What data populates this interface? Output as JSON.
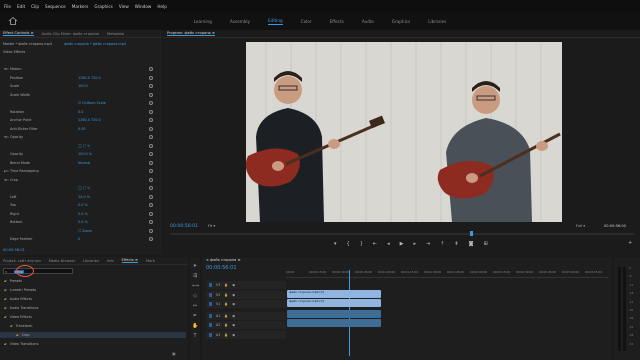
{
  "menu": [
    "File",
    "Edit",
    "Clip",
    "Sequence",
    "Markers",
    "Graphics",
    "View",
    "Window",
    "Help"
  ],
  "workspaces": [
    "Learning",
    "Assembly",
    "Editing",
    "Color",
    "Effects",
    "Audio",
    "Graphics",
    "Libraries"
  ],
  "active_workspace": "Editing",
  "effect_controls": {
    "tabs": [
      "Effect Controls ≡",
      "Audio Clip Mixer: фейк сторона",
      "Metadata"
    ],
    "source_line": "Master * фейк сторона.mp4",
    "clip_line": "фейк сторона * фейк сторона.mp4",
    "section": "Video Effects",
    "rows": [
      {
        "tri": "▼",
        "fx": "fx",
        "label": "Motion",
        "value": ""
      },
      {
        "tri": "",
        "fx": "",
        "label": "Position",
        "value": "1280.0    720.0"
      },
      {
        "tri": "",
        "fx": "",
        "label": "Scale",
        "value": "100.0"
      },
      {
        "tri": "",
        "fx": "",
        "label": "Scale Width",
        "value": ""
      },
      {
        "tri": "",
        "fx": "",
        "label": "",
        "value": "☑ Uniform Scale"
      },
      {
        "tri": "",
        "fx": "",
        "label": "Rotation",
        "value": "0.0"
      },
      {
        "tri": "",
        "fx": "",
        "label": "Anchor Point",
        "value": "1280.0    720.0"
      },
      {
        "tri": "",
        "fx": "",
        "label": "Anti-flicker Filter",
        "value": "0.00"
      },
      {
        "tri": "▼",
        "fx": "fx",
        "label": "Opacity",
        "value": ""
      },
      {
        "tri": "",
        "fx": "",
        "label": "",
        "value": "◯ ▢ ✎"
      },
      {
        "tri": "",
        "fx": "",
        "label": "Opacity",
        "value": "100.0 %"
      },
      {
        "tri": "",
        "fx": "",
        "label": "Blend Mode",
        "value": "Normal"
      },
      {
        "tri": "▶",
        "fx": "fx",
        "label": "Time Remapping",
        "value": ""
      },
      {
        "tri": "▼",
        "fx": "fx",
        "label": "Crop",
        "value": ""
      },
      {
        "tri": "",
        "fx": "",
        "label": "",
        "value": "◯ ▢ ✎"
      },
      {
        "tri": "",
        "fx": "",
        "label": "Left",
        "value": "14.0 %"
      },
      {
        "tri": "",
        "fx": "",
        "label": "Top",
        "value": "0.0 %"
      },
      {
        "tri": "",
        "fx": "",
        "label": "Right",
        "value": "0.0 %"
      },
      {
        "tri": "",
        "fx": "",
        "label": "Bottom",
        "value": "0.0 %"
      },
      {
        "tri": "",
        "fx": "",
        "label": "",
        "value": "☐ Zoom"
      },
      {
        "tri": "",
        "fx": "",
        "label": "Edge Feather",
        "value": "0"
      }
    ],
    "timecode": "00:00:56:01"
  },
  "program": {
    "title": "Program: фейк сторона ≡",
    "timecode": "00:00:56:01",
    "fit": "Fit",
    "quality": "Full",
    "duration": "00:00:56:00"
  },
  "project": {
    "tabs": [
      "Project: сайт внутри",
      "Media Browser",
      "Libraries",
      "Info",
      "Effects ≡",
      "Mark"
    ],
    "search": "crop",
    "items": [
      {
        "indent": 0,
        "label": "Presets"
      },
      {
        "indent": 0,
        "label": "Lumetri Presets"
      },
      {
        "indent": 0,
        "label": "Audio Effects"
      },
      {
        "indent": 0,
        "label": "Audio Transitions"
      },
      {
        "indent": 0,
        "label": "Video Effects"
      },
      {
        "indent": 1,
        "label": "Transform"
      },
      {
        "indent": 2,
        "label": "Crop"
      },
      {
        "indent": 0,
        "label": "Video Transitions"
      }
    ]
  },
  "timeline": {
    "tab": "× фейк сторона ≡",
    "timecode": "00:00:56:01",
    "ruler": [
      "00:00",
      "00:00:15:00",
      "00:00:30:00",
      "00:00:45:00",
      "00:01:00:00",
      "00:01:15:00",
      "00:01:30:00",
      "00:01:45:00",
      "00:02:00:00",
      "00:02:15:00",
      "00:02:30:00",
      "00:02:45:00",
      "00:03:00:00",
      "00:03:15:00"
    ],
    "tracks": [
      "V3",
      "V2",
      "V1",
      "A1",
      "A2",
      "A3"
    ],
    "clips": [
      {
        "label": "фейк сторона.mp4 [V]",
        "track": "V2"
      },
      {
        "label": "фейк сторона.mp4 [V]",
        "track": "V1"
      }
    ],
    "meter_labels": [
      "0",
      "-6",
      "-12",
      "-18",
      "-24",
      "-30",
      "-36",
      "-42",
      "-48",
      "-54"
    ]
  },
  "colors": {
    "accent": "#3b9bdf",
    "video_clip": "#8fb5e0",
    "audio_clip": "#3e6e96",
    "bg": "#1e1e1e"
  }
}
